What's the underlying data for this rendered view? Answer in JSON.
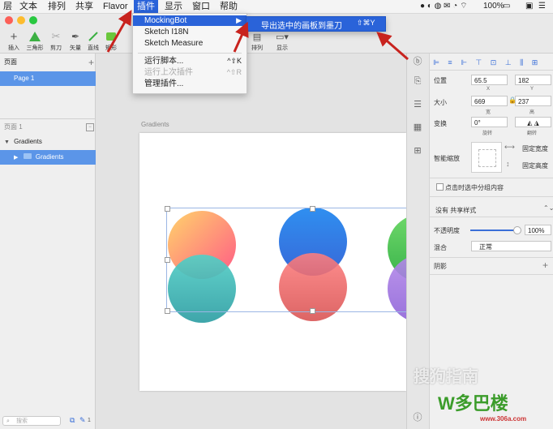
{
  "menubar": {
    "items": [
      "层",
      "文本",
      "排列",
      "共享",
      "Flavor",
      "插件",
      "显示",
      "窗口",
      "帮助"
    ],
    "battery": "100%"
  },
  "toolbar": {
    "tools": [
      "插入",
      "三角形",
      "剪刀",
      "矢量",
      "直线",
      "矩形"
    ],
    "right_tools": [
      "排列",
      "显示"
    ]
  },
  "plugin_menu": {
    "items": [
      {
        "label": "MockingBot",
        "shortcut": "▶"
      },
      {
        "label": "Sketch I18N",
        "shortcut": ""
      },
      {
        "label": "Sketch Measure",
        "shortcut": ""
      },
      {
        "label": "运行脚本...",
        "shortcut": "^⇧K"
      },
      {
        "label": "运行上次插件",
        "shortcut": "^⇧R"
      },
      {
        "label": "管理插件...",
        "shortcut": ""
      }
    ]
  },
  "submenu": {
    "label": "导出选中的画板到墨刀",
    "shortcut": "⇧⌘Y"
  },
  "left": {
    "pages_title": "页面",
    "page_item": "Page 1",
    "layers_title": "页面 1",
    "group": "Gradients",
    "child": "Gradients",
    "search_placeholder": "搜索",
    "count": "1"
  },
  "canvas": {
    "artboard_label": "Gradients"
  },
  "inspector": {
    "position_label": "位置",
    "x_value": "65.5",
    "y_value": "182",
    "x_sub": "X",
    "y_sub": "Y",
    "size_label": "大小",
    "w_value": "669",
    "h_value": "237",
    "w_sub": "宽",
    "h_sub": "高",
    "transform_label": "变换",
    "rotate_value": "0°",
    "rotate_sub": "旋转",
    "flip_sub": "翻转",
    "resize_label": "智能缩放",
    "fix_width": "固定宽度",
    "fix_height": "固定高度",
    "click_select": "点击时选中分组内容",
    "shared_style": "没有 共享样式",
    "opacity_label": "不透明度",
    "opacity_value": "100%",
    "blend_label": "混合",
    "blend_value": "正常",
    "shadow_label": "阴影"
  },
  "watermark": {
    "text1": "搜狗指南",
    "text2": "W多巴楼",
    "url": "www.306a.com"
  },
  "colors": {
    "accent": "#2a63d9",
    "selection": "#5b95e8"
  }
}
